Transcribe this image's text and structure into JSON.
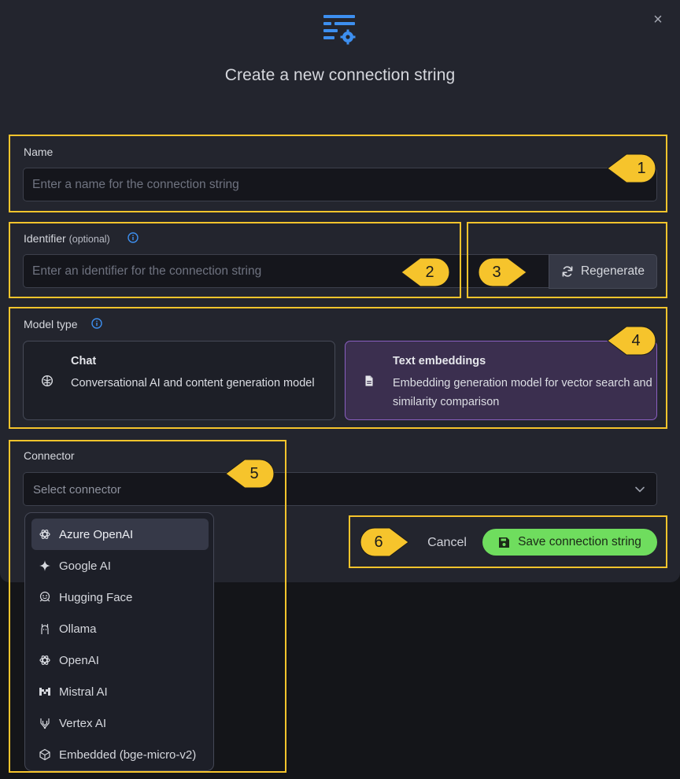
{
  "modal": {
    "title": "Create a new connection string",
    "close_label": "×"
  },
  "name_field": {
    "label": "Name",
    "placeholder": "Enter a name for the connection string",
    "value": ""
  },
  "identifier_field": {
    "label": "Identifier",
    "label_suffix": "(optional)",
    "placeholder": "Enter an identifier for the connection string",
    "value": "",
    "regenerate_label": "Regenerate"
  },
  "model_type": {
    "label": "Model type",
    "options": [
      {
        "title": "Chat",
        "description": "Conversational AI and content generation model",
        "icon": "chat-brain-icon",
        "selected": false
      },
      {
        "title": "Text embeddings",
        "description": "Embedding generation model for vector search and similarity comparison",
        "icon": "document-icon",
        "selected": true
      }
    ]
  },
  "connector": {
    "label": "Connector",
    "placeholder": "Select connector",
    "options": [
      {
        "label": "Azure OpenAI",
        "icon": "openai-icon",
        "highlighted": true
      },
      {
        "label": "Google AI",
        "icon": "sparkle-icon",
        "highlighted": false
      },
      {
        "label": "Hugging Face",
        "icon": "hugging-face-icon",
        "highlighted": false
      },
      {
        "label": "Ollama",
        "icon": "ollama-icon",
        "highlighted": false
      },
      {
        "label": "OpenAI",
        "icon": "openai-icon",
        "highlighted": false
      },
      {
        "label": "Mistral AI",
        "icon": "mistral-icon",
        "highlighted": false
      },
      {
        "label": "Vertex AI",
        "icon": "vertex-icon",
        "highlighted": false
      },
      {
        "label": "Embedded (bge-micro-v2)",
        "icon": "embedded-icon",
        "highlighted": false
      }
    ]
  },
  "footer": {
    "cancel_label": "Cancel",
    "save_label": "Save connection string"
  },
  "annotations": [
    "1",
    "2",
    "3",
    "4",
    "5",
    "6"
  ],
  "colors": {
    "accent_blue": "#3d8ff0",
    "annotation_yellow": "#f6c42c",
    "save_green": "#6fdd5e",
    "selected_card": "#3b2f4f"
  }
}
